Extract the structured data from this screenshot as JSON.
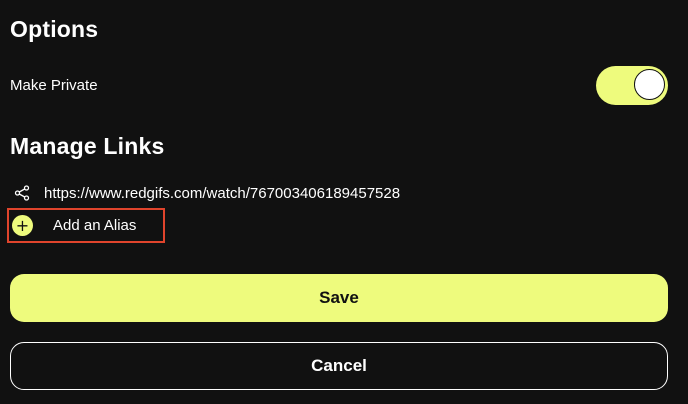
{
  "options": {
    "title": "Options",
    "make_private": {
      "label": "Make Private",
      "enabled": true
    }
  },
  "manage_links": {
    "title": "Manage Links",
    "link": {
      "icon": "share-icon",
      "url": "https://www.redgifs.com/watch/767003406189457528"
    },
    "add_alias": {
      "icon": "plus-icon",
      "label": "Add an Alias"
    }
  },
  "buttons": {
    "save_label": "Save",
    "cancel_label": "Cancel"
  },
  "colors": {
    "background": "#111111",
    "accent": "#eefb7d",
    "highlight_border": "#e0442c",
    "text": "#ffffff"
  }
}
